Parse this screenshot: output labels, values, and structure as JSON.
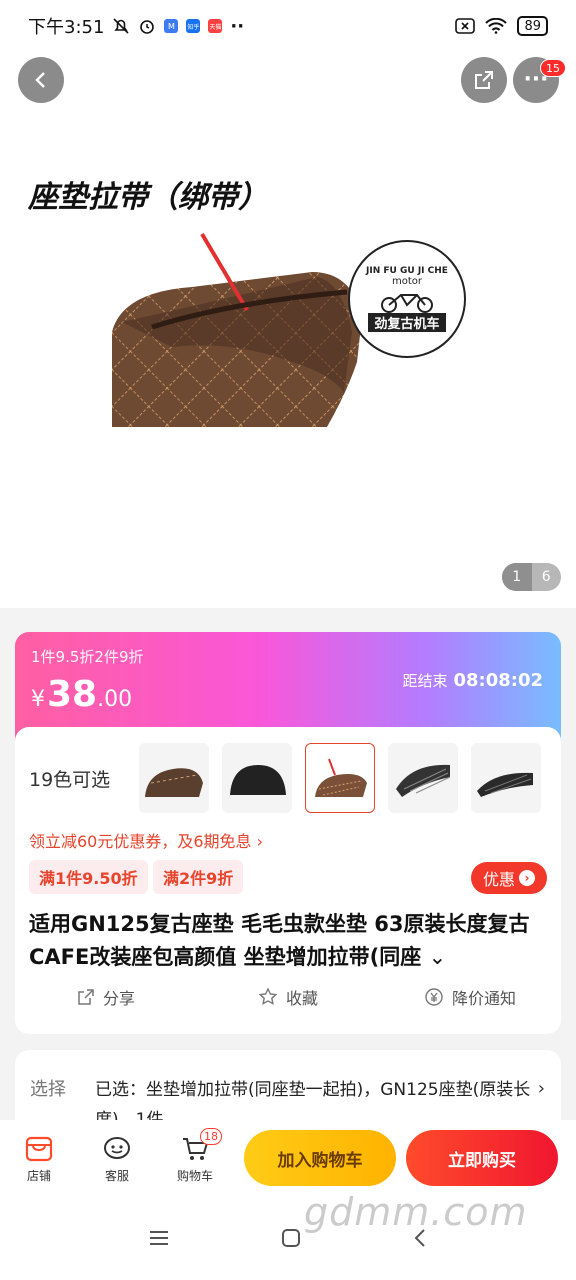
{
  "status_bar": {
    "time": "下午3:51",
    "battery": "89",
    "apps": [
      "M",
      "知乎",
      "天猫"
    ]
  },
  "hero": {
    "caption": "座垫拉带（绑带）",
    "logo_text": "JIN FU GU JI CHE",
    "logo_motor": "motor",
    "logo_cn": "劲复古机车",
    "pager_current": "1",
    "pager_total": "6",
    "more_badge": "15"
  },
  "price": {
    "promo": "1件9.5折2件9折",
    "currency": "¥",
    "integer": "38",
    "decimal": ".00",
    "countdown_label": "距结束",
    "countdown_value": "08:08:02"
  },
  "colors": {
    "label": "19色可选",
    "selected_index": 2
  },
  "coupon": {
    "text": "领立减60元优惠券，及6期免息 ›"
  },
  "tags": [
    "满1件9.50折",
    "满2件9折"
  ],
  "discount_button": "优惠",
  "product_title": "适用GN125复古座垫 毛毛虫款坐垫 63原装长度复古CAFE改装座包高颜值 坐垫增加拉带(同座",
  "actions": {
    "share": "分享",
    "favorite": "收藏",
    "price_alert": "降价通知"
  },
  "spec": {
    "label": "选择",
    "value": "已选：坐垫增加拉带(同座垫一起拍)，GN125座垫(原装长度)，1件"
  },
  "bottom_bar": {
    "store": "店铺",
    "service": "客服",
    "cart": "购物车",
    "cart_count": "18",
    "add_to_cart": "加入购物车",
    "buy_now": "立即购买"
  },
  "watermark": "gdmm.com",
  "accent_colors": {
    "primary_red": "#f2382a",
    "yellow": "#ffcb16",
    "coupon_text": "#e6442c"
  }
}
